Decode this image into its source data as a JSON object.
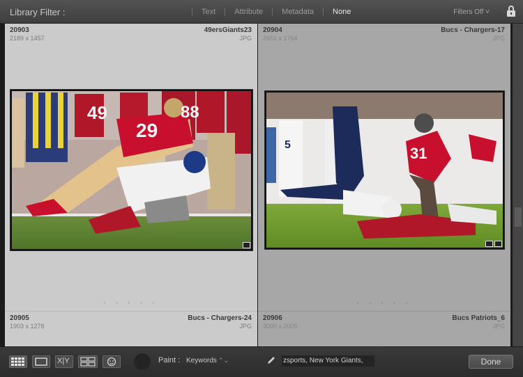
{
  "filter_bar": {
    "title": "Library Filter :",
    "options": [
      {
        "label": "Text",
        "active": false
      },
      {
        "label": "Attribute",
        "active": false
      },
      {
        "label": "Metadata",
        "active": false
      },
      {
        "label": "None",
        "active": true
      }
    ],
    "preset": "Filters Off ˅",
    "lock_icon": "lock-icon"
  },
  "grid": {
    "cells": [
      {
        "index": "20903",
        "filename": "49ersGiants23",
        "dimensions": "2189 x 1457",
        "extension": "JPG",
        "selected": true,
        "image": "photo-49ers-vs-giants-tackle"
      },
      {
        "index": "20904",
        "filename": "Bucs - Chargers-17",
        "dimensions": "2651 x 1764",
        "extension": "JPG",
        "selected": false,
        "image": "photo-bucs-vs-chargers-tackle"
      },
      {
        "index": "20905",
        "filename": "Bucs - Chargers-24",
        "dimensions": "1903 x 1278",
        "extension": "JPG"
      },
      {
        "index": "20906",
        "filename": "Bucs Patriots_6",
        "dimensions": "3000 x 2005",
        "extension": "JPG"
      }
    ],
    "dots": ". . . . ."
  },
  "toolbar": {
    "view_buttons": [
      "grid-view-icon",
      "loupe-view-icon",
      "compare-view-icon",
      "survey-view-icon",
      "people-view-icon"
    ],
    "compare_label": "X|Y",
    "paint_label": "Paint :",
    "paint_mode": "Keywords",
    "paint_mode_arrow": "⌃⌄",
    "keywords_value": "zsports, New York Giants,",
    "done_label": "Done"
  },
  "colors": {
    "selected_cell": "#cbcbcb",
    "unselected_cell": "#a7a7a7",
    "panel": "#3a3a3a",
    "niners_red": "#b0182a",
    "bucs_red": "#c8102e",
    "chargers_navy": "#1d2b5a"
  }
}
